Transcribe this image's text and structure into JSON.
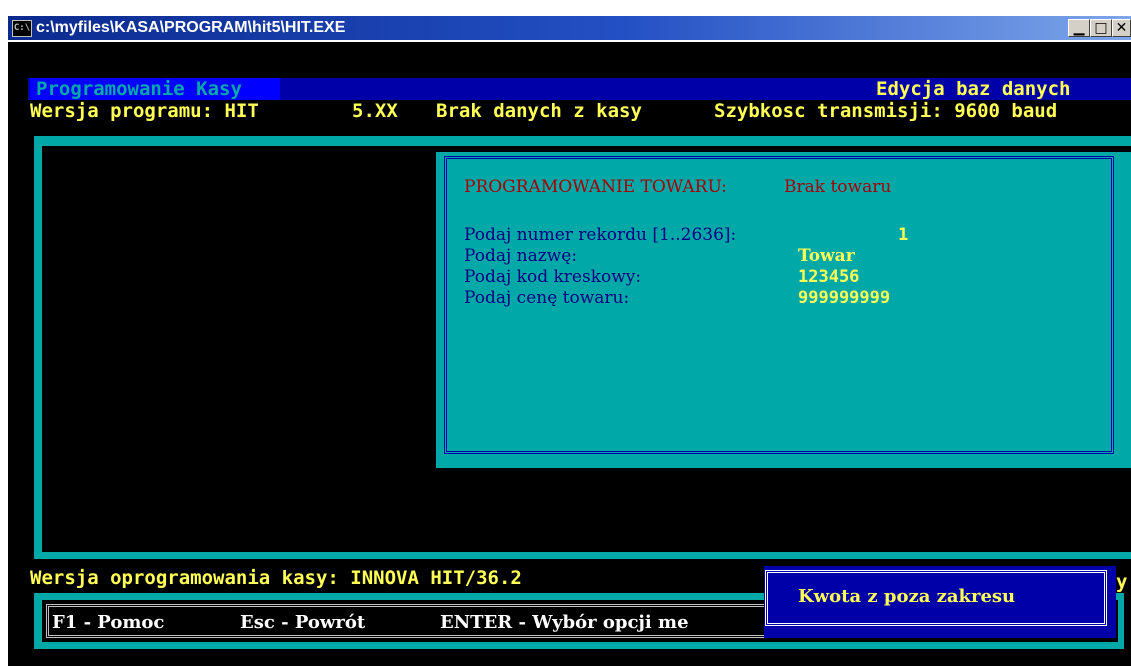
{
  "window": {
    "title": "c:\\myfiles\\KASA\\PROGRAM\\hit5\\HIT.EXE",
    "icon_text": "C:\\",
    "min_glyph": "▁",
    "max_glyph": "□",
    "close_glyph": "✕"
  },
  "header": {
    "left_title": "Programowanie Kasy",
    "right_title": "Edycja baz danych",
    "version_label": "Wersja programu: HIT",
    "version_value": "5.XX",
    "data_status": "Brak danych z kasy",
    "transmission": "Szybkosc transmisji: 9600 baud"
  },
  "dialog": {
    "title": "PROGRAMOWANIE TOWARU:",
    "status": "Brak towaru",
    "fields": [
      {
        "label": "Podaj numer rekordu [1..2636]:",
        "value": "1"
      },
      {
        "label": "Podaj nazwę:",
        "value": "Towar"
      },
      {
        "label": "Podaj kod kreskowy:",
        "value": "123456"
      },
      {
        "label": "Podaj cenę towaru:",
        "value": "999999999"
      }
    ]
  },
  "status_line": {
    "firmware": "Wersja oprogramowania kasy: INNOVA HIT/36.2",
    "trailing": "y"
  },
  "footer": {
    "f1": "F1 - Pomoc",
    "esc": "Esc - Powrót",
    "enter": "ENTER - Wybór opcji me"
  },
  "popup": {
    "message": "Kwota z poza zakresu"
  },
  "colors": {
    "console_bg": "#000000",
    "cyan": "#00a8a8",
    "dark_blue": "#0000a8",
    "yellow": "#ffff55",
    "red": "#a80000"
  }
}
